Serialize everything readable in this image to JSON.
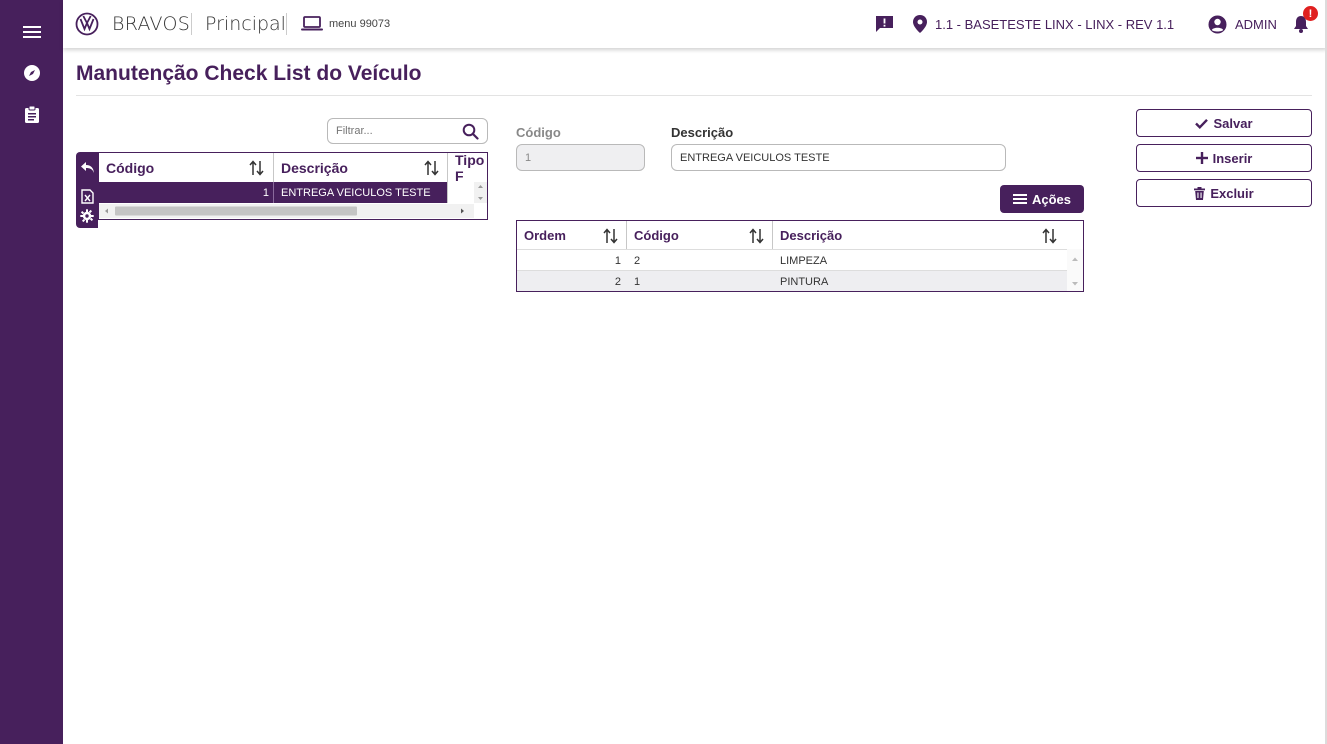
{
  "topbar": {
    "brand": "BRAVOS",
    "section": "Principal",
    "menu_label": "menu 99073",
    "location": "1.1 - BASETESTE LINX - LINX - REV 1.1",
    "user": "ADMIN",
    "notification_badge": "!"
  },
  "page": {
    "title": "Manutenção Check List do Veículo"
  },
  "filter": {
    "placeholder": "Filtrar..."
  },
  "list_grid": {
    "columns": [
      "Código",
      "Descrição",
      "Tipo F"
    ],
    "rows": [
      {
        "codigo": "1",
        "descricao": "ENTREGA VEICULOS TESTE"
      }
    ]
  },
  "form": {
    "codigo_label": "Código",
    "codigo_value": "1",
    "descricao_label": "Descrição",
    "descricao_value": "ENTREGA VEICULOS TESTE"
  },
  "acoes_label": "Ações",
  "items_grid": {
    "columns": [
      "Ordem",
      "Código",
      "Descrição"
    ],
    "rows": [
      {
        "ordem": "1",
        "codigo": "2",
        "descricao": "LIMPEZA"
      },
      {
        "ordem": "2",
        "codigo": "1",
        "descricao": "PINTURA"
      }
    ]
  },
  "actions": {
    "salvar": "Salvar",
    "inserir": "Inserir",
    "excluir": "Excluir"
  },
  "colors": {
    "primary": "#47205c",
    "badge": "#e02020"
  }
}
